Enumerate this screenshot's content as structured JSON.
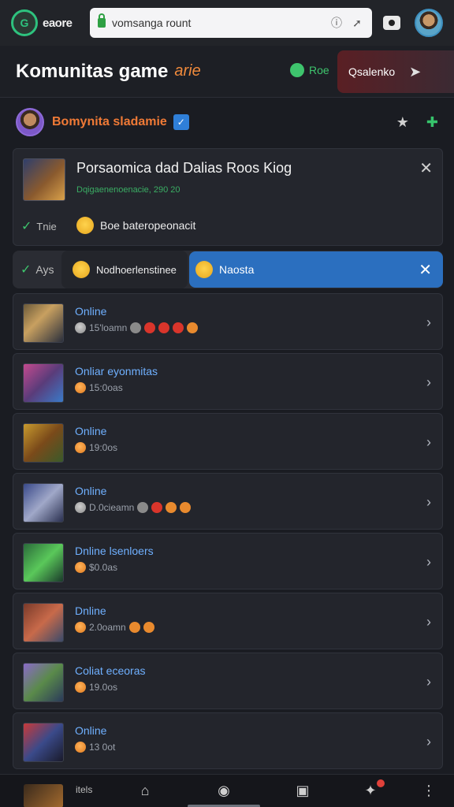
{
  "browser": {
    "brand_name": "eaore",
    "brand_logo_glyph": "G",
    "url": "vomsanga rount",
    "accent": "#2ec27e"
  },
  "header": {
    "title": "Komunitas game",
    "accent_text": "arie",
    "chat_label": "Roe",
    "action_label": "Qsalenko",
    "action_icon": "send-icon"
  },
  "profile": {
    "name": "Bomynita sladamie",
    "verified_glyph": "✓"
  },
  "post": {
    "title": "Porsaomica dad Dalias Roos Kiog",
    "subtitle": "Dqigaenenoenacie, 290 20",
    "check_label": "Tnie",
    "reaction_label": "Boe bateropeonacit"
  },
  "filter": {
    "check_label": "Ays",
    "chip_label": "Nodhoerlenstinee",
    "active_label": "Naosta"
  },
  "rows": [
    {
      "status": "Online",
      "meta": "15'loamn",
      "thumb": "linear-gradient(135deg,#6b5a3a,#c8a060 40%,#2a2f3c)",
      "coin": "gray",
      "badges": [
        "gray",
        "red",
        "red",
        "red",
        "orange"
      ]
    },
    {
      "status": "Onliar eyonmitas",
      "meta": "15:0oas",
      "thumb": "linear-gradient(135deg,#c34a8e,#5a3c7a 50%,#3a7ac8)",
      "coin": "orange",
      "badges": []
    },
    {
      "status": "Online",
      "meta": "19:0os",
      "thumb": "linear-gradient(135deg,#c89a2e,#7a4a1a 50%,#3a5a2a)",
      "coin": "orange",
      "badges": []
    },
    {
      "status": "Online",
      "meta": "D.0cieamn",
      "thumb": "linear-gradient(135deg,#3a4a8a,#a0a8c8 50%,#2a3050)",
      "coin": "gray",
      "badges": [
        "gray",
        "red",
        "orange",
        "orange"
      ]
    },
    {
      "status": "Dnline lsenloers",
      "meta": "$0.0as",
      "thumb": "linear-gradient(135deg,#2a6a3a,#5ac85a 50%,#1a3a2a)",
      "coin": "orange",
      "badges": []
    },
    {
      "status": "Dnline",
      "meta": "2.0oamn",
      "thumb": "linear-gradient(135deg,#7a3a2a,#c86a4a 50%,#3a4a6a)",
      "coin": "orange",
      "badges": [
        "orange",
        "orange"
      ]
    },
    {
      "status": "Coliat eceoras",
      "meta": "19.0os",
      "thumb": "linear-gradient(135deg,#8a6ac8,#5a8a4a 50%,#2a3a5a)",
      "coin": "orange",
      "badges": []
    },
    {
      "status": "Online",
      "meta": "13 0ot",
      "thumb": "linear-gradient(135deg,#c83a3a,#3a4a8a 50%,#1a1a2a)",
      "coin": "orange",
      "badges": []
    }
  ],
  "bottom": {
    "text": "itels"
  }
}
